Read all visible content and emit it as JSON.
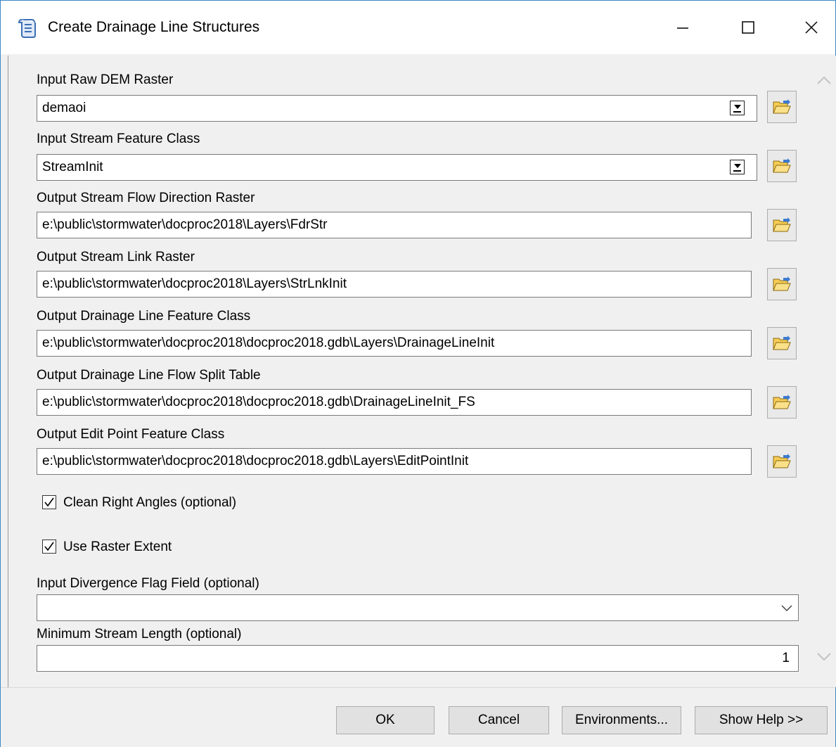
{
  "window": {
    "title": "Create Drainage Line Structures",
    "icon": "script-tool-icon"
  },
  "params": [
    {
      "label": "Input Raw DEM Raster",
      "value": "demaoi",
      "type": "combo"
    },
    {
      "label": "Input Stream Feature Class",
      "value": "StreamInit",
      "type": "combo"
    },
    {
      "label": "Output Stream Flow Direction Raster",
      "value": "e:\\public\\stormwater\\docproc2018\\Layers\\FdrStr",
      "type": "text"
    },
    {
      "label": "Output Stream Link Raster",
      "value": "e:\\public\\stormwater\\docproc2018\\Layers\\StrLnkInit",
      "type": "text"
    },
    {
      "label": "Output Drainage Line Feature Class",
      "value": "e:\\public\\stormwater\\docproc2018\\docproc2018.gdb\\Layers\\DrainageLineInit",
      "type": "text"
    },
    {
      "label": "Output Drainage Line Flow Split Table",
      "value": "e:\\public\\stormwater\\docproc2018\\docproc2018.gdb\\DrainageLineInit_FS",
      "type": "text"
    },
    {
      "label": "Output Edit Point Feature Class",
      "value": "e:\\public\\stormwater\\docproc2018\\docproc2018.gdb\\Layers\\EditPointInit",
      "type": "text"
    }
  ],
  "checkboxes": [
    {
      "label": "Clean Right Angles (optional)",
      "checked": true
    },
    {
      "label": "Use Raster Extent",
      "checked": true
    }
  ],
  "divergence": {
    "label": "Input Divergence Flag Field (optional)",
    "value": ""
  },
  "min_length": {
    "label": "Minimum Stream Length (optional)",
    "value": "1"
  },
  "buttons": {
    "ok": "OK",
    "cancel": "Cancel",
    "environments": "Environments...",
    "help": "Show Help >>"
  }
}
